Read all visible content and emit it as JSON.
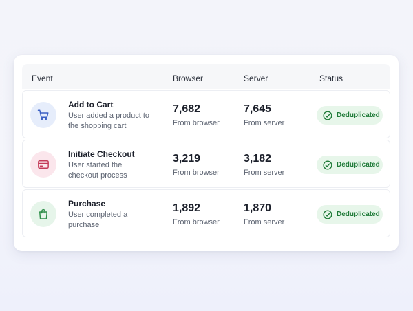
{
  "table": {
    "headers": {
      "event": "Event",
      "browser": "Browser",
      "server": "Server",
      "status": "Status"
    },
    "rows": [
      {
        "icon": "cart-icon",
        "icon_color": "#3b5fc4",
        "icon_bg": "#e6edfb",
        "title": "Add to Cart",
        "description": "User added a product to the shopping cart",
        "browser_count": "7,682",
        "browser_label": "From browser",
        "server_count": "7,645",
        "server_label": "From server",
        "status": "Deduplicated"
      },
      {
        "icon": "credit-card-icon",
        "icon_color": "#c43b58",
        "icon_bg": "#fbe6ec",
        "title": "Initiate Checkout",
        "description": "User started the checkout process",
        "browser_count": "3,219",
        "browser_label": "From browser",
        "server_count": "3,182",
        "server_label": "From server",
        "status": "Deduplicated"
      },
      {
        "icon": "shopping-bag-icon",
        "icon_color": "#2f8f4a",
        "icon_bg": "#e6f5ea",
        "title": "Purchase",
        "description": "User completed a purchase",
        "browser_count": "1,892",
        "browser_label": "From browser",
        "server_count": "1,870",
        "server_label": "From server",
        "status": "Deduplicated"
      }
    ]
  },
  "colors": {
    "status_text": "#1f7a38",
    "status_bg": "#e7f6ea"
  }
}
